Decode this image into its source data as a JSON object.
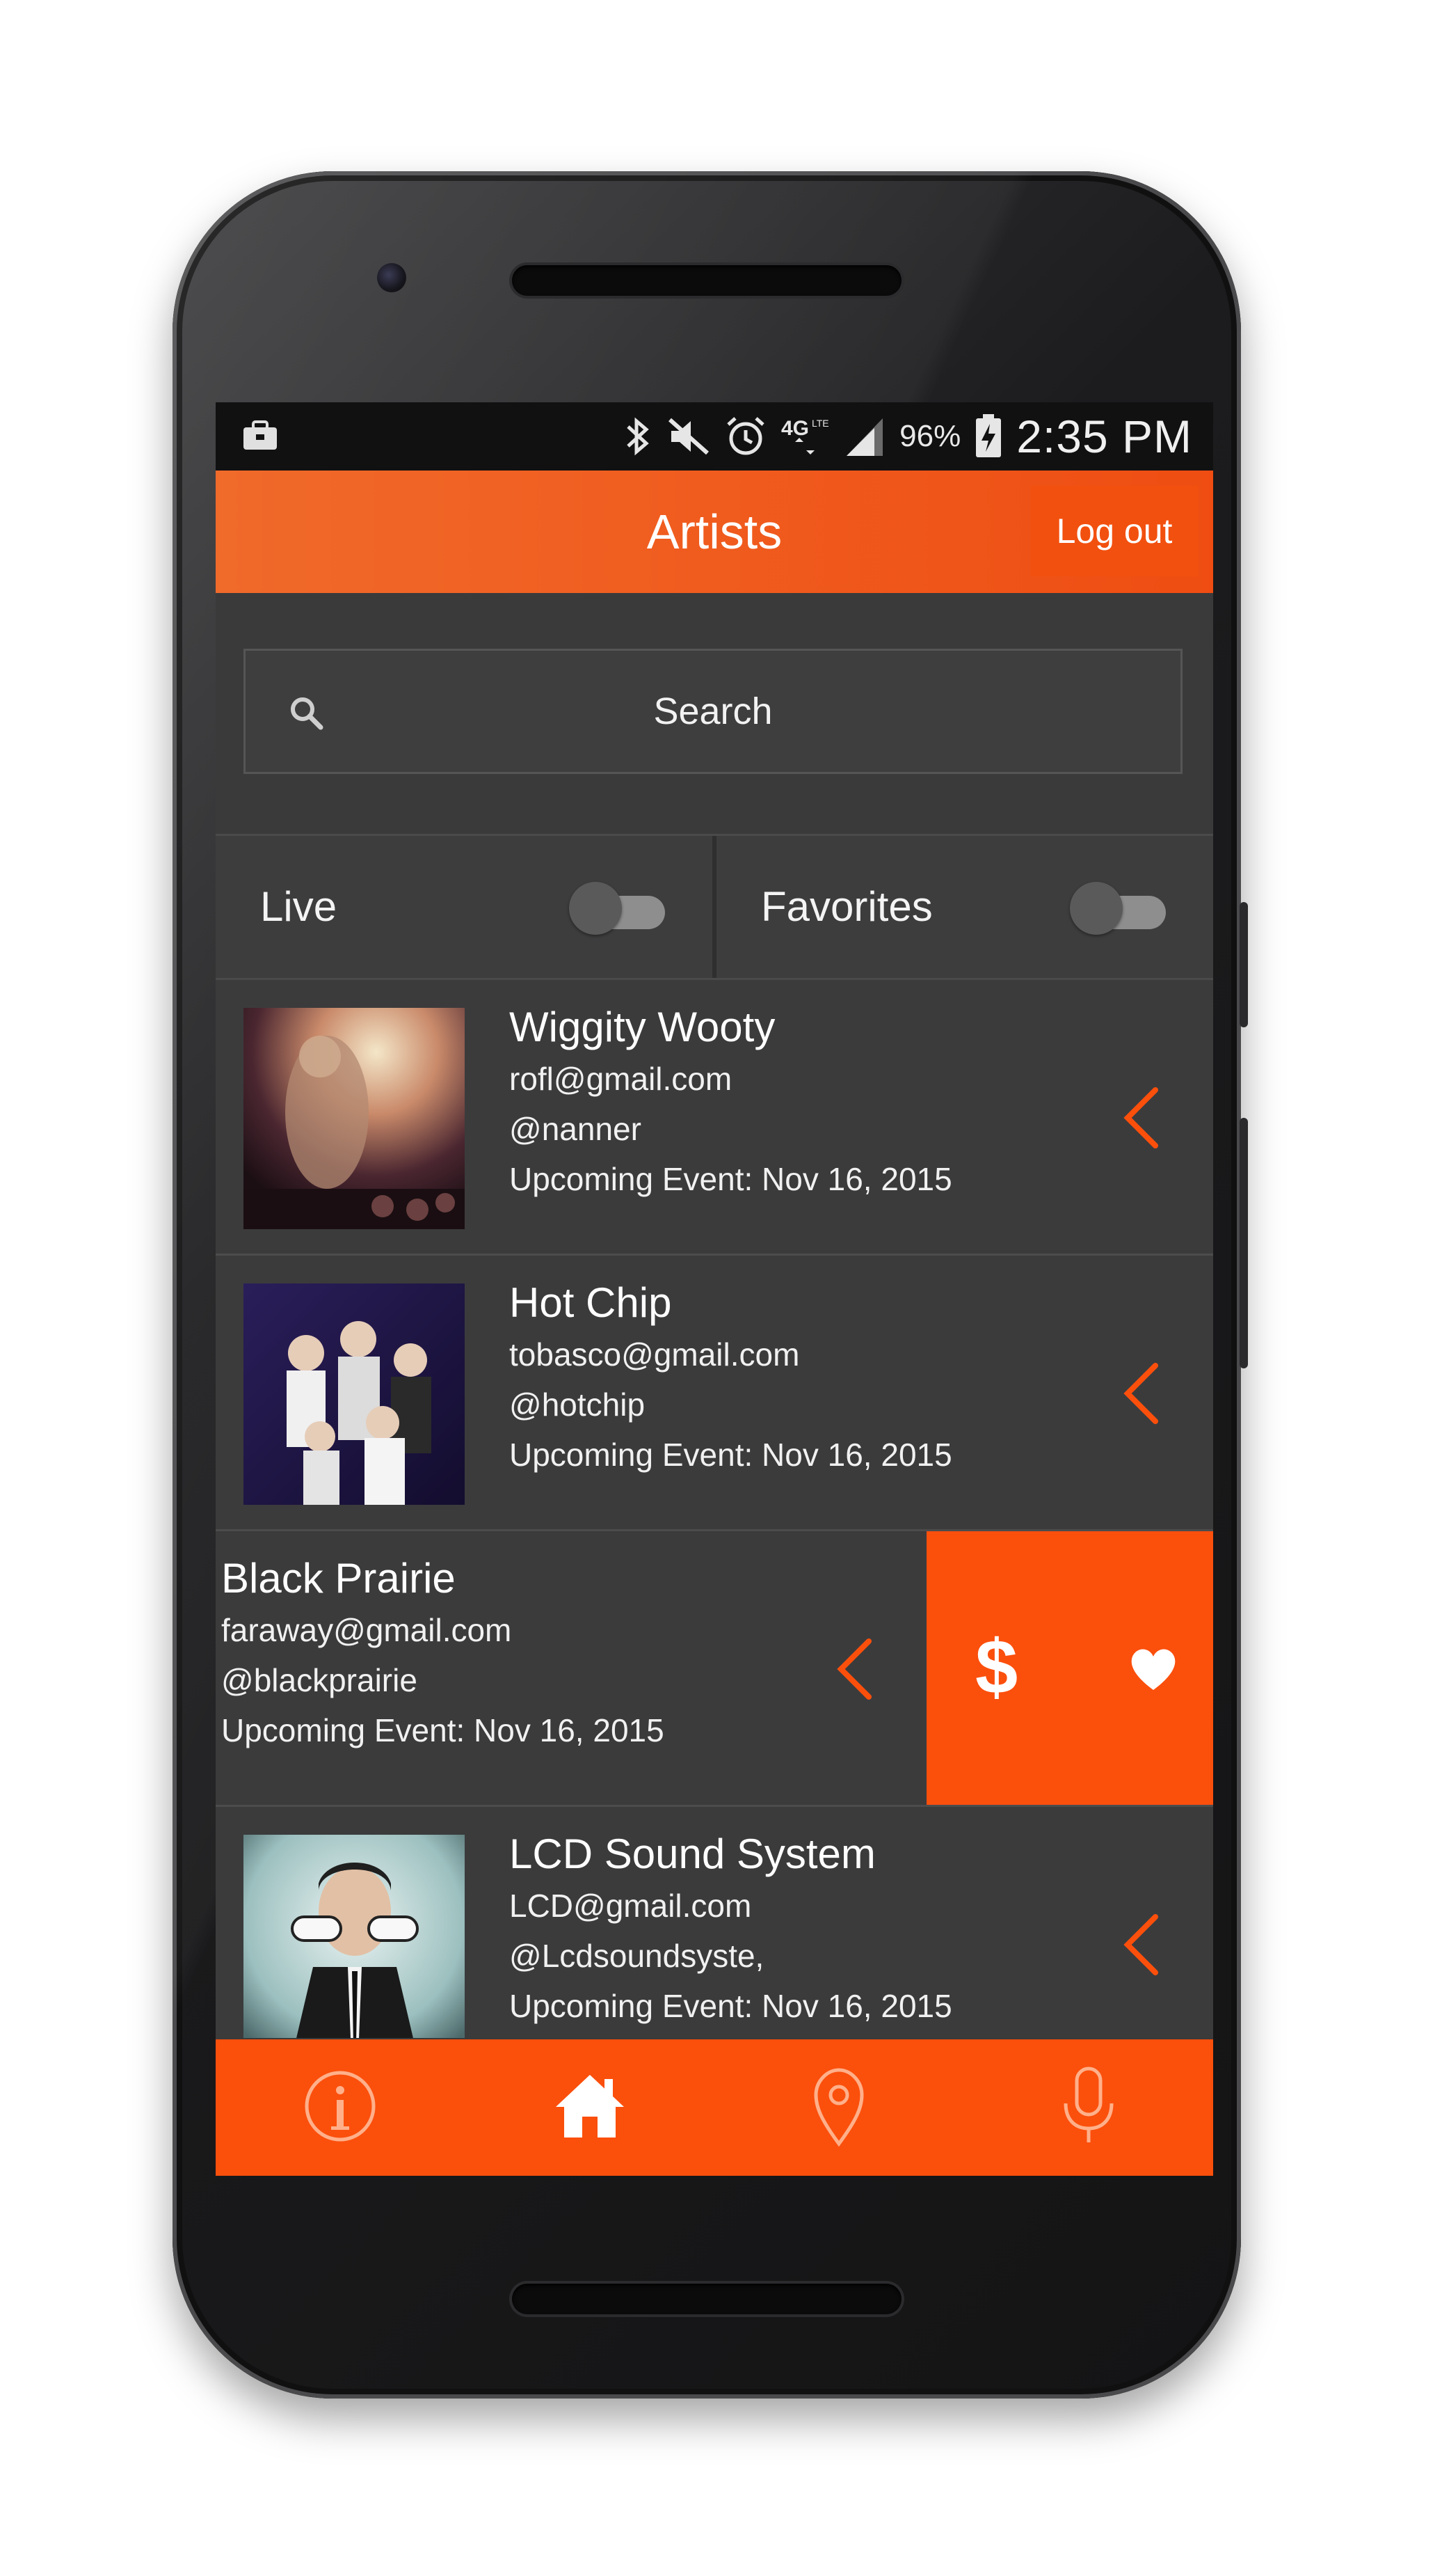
{
  "status_bar": {
    "battery_percent": "96%",
    "time": "2:35 PM",
    "network_label": "4G LTE",
    "icons": [
      "briefcase-icon",
      "bluetooth-icon",
      "mute-icon",
      "alarm-icon",
      "network-4g-icon",
      "signal-icon",
      "battery-charging-icon"
    ]
  },
  "header": {
    "title": "Artists",
    "logout_label": "Log out"
  },
  "search": {
    "placeholder": "Search"
  },
  "filters": {
    "live_label": "Live",
    "live_on": false,
    "favorites_label": "Favorites",
    "favorites_on": false
  },
  "artists": [
    {
      "name": "Wiggity Wooty",
      "email": "rofl@gmail.com",
      "handle": "@nanner",
      "event": "Upcoming Event: Nov 16, 2015"
    },
    {
      "name": "Hot Chip",
      "email": "tobasco@gmail.com",
      "handle": "@hotchip",
      "event": "Upcoming Event: Nov 16, 2015"
    },
    {
      "name": "Black Prairie",
      "email": "faraway@gmail.com",
      "handle": "@blackprairie",
      "event": "Upcoming Event: Nov 16, 2015",
      "actions": {
        "tip_label": "$",
        "favorite_icon": "heart-icon"
      }
    },
    {
      "name": "LCD Sound System",
      "email": "LCD@gmail.com",
      "handle": "@Lcdsoundsyste,",
      "event": "Upcoming Event: Nov 16, 2015"
    }
  ],
  "bottom_nav": {
    "items": [
      "info-icon",
      "home-icon",
      "map-pin-icon",
      "microphone-icon"
    ],
    "active": "home-icon"
  },
  "colors": {
    "accent": "#fb4f0c",
    "header_gradient_start": "#f06a2a",
    "background": "#3b3b3c",
    "statusbar": "#111112"
  }
}
